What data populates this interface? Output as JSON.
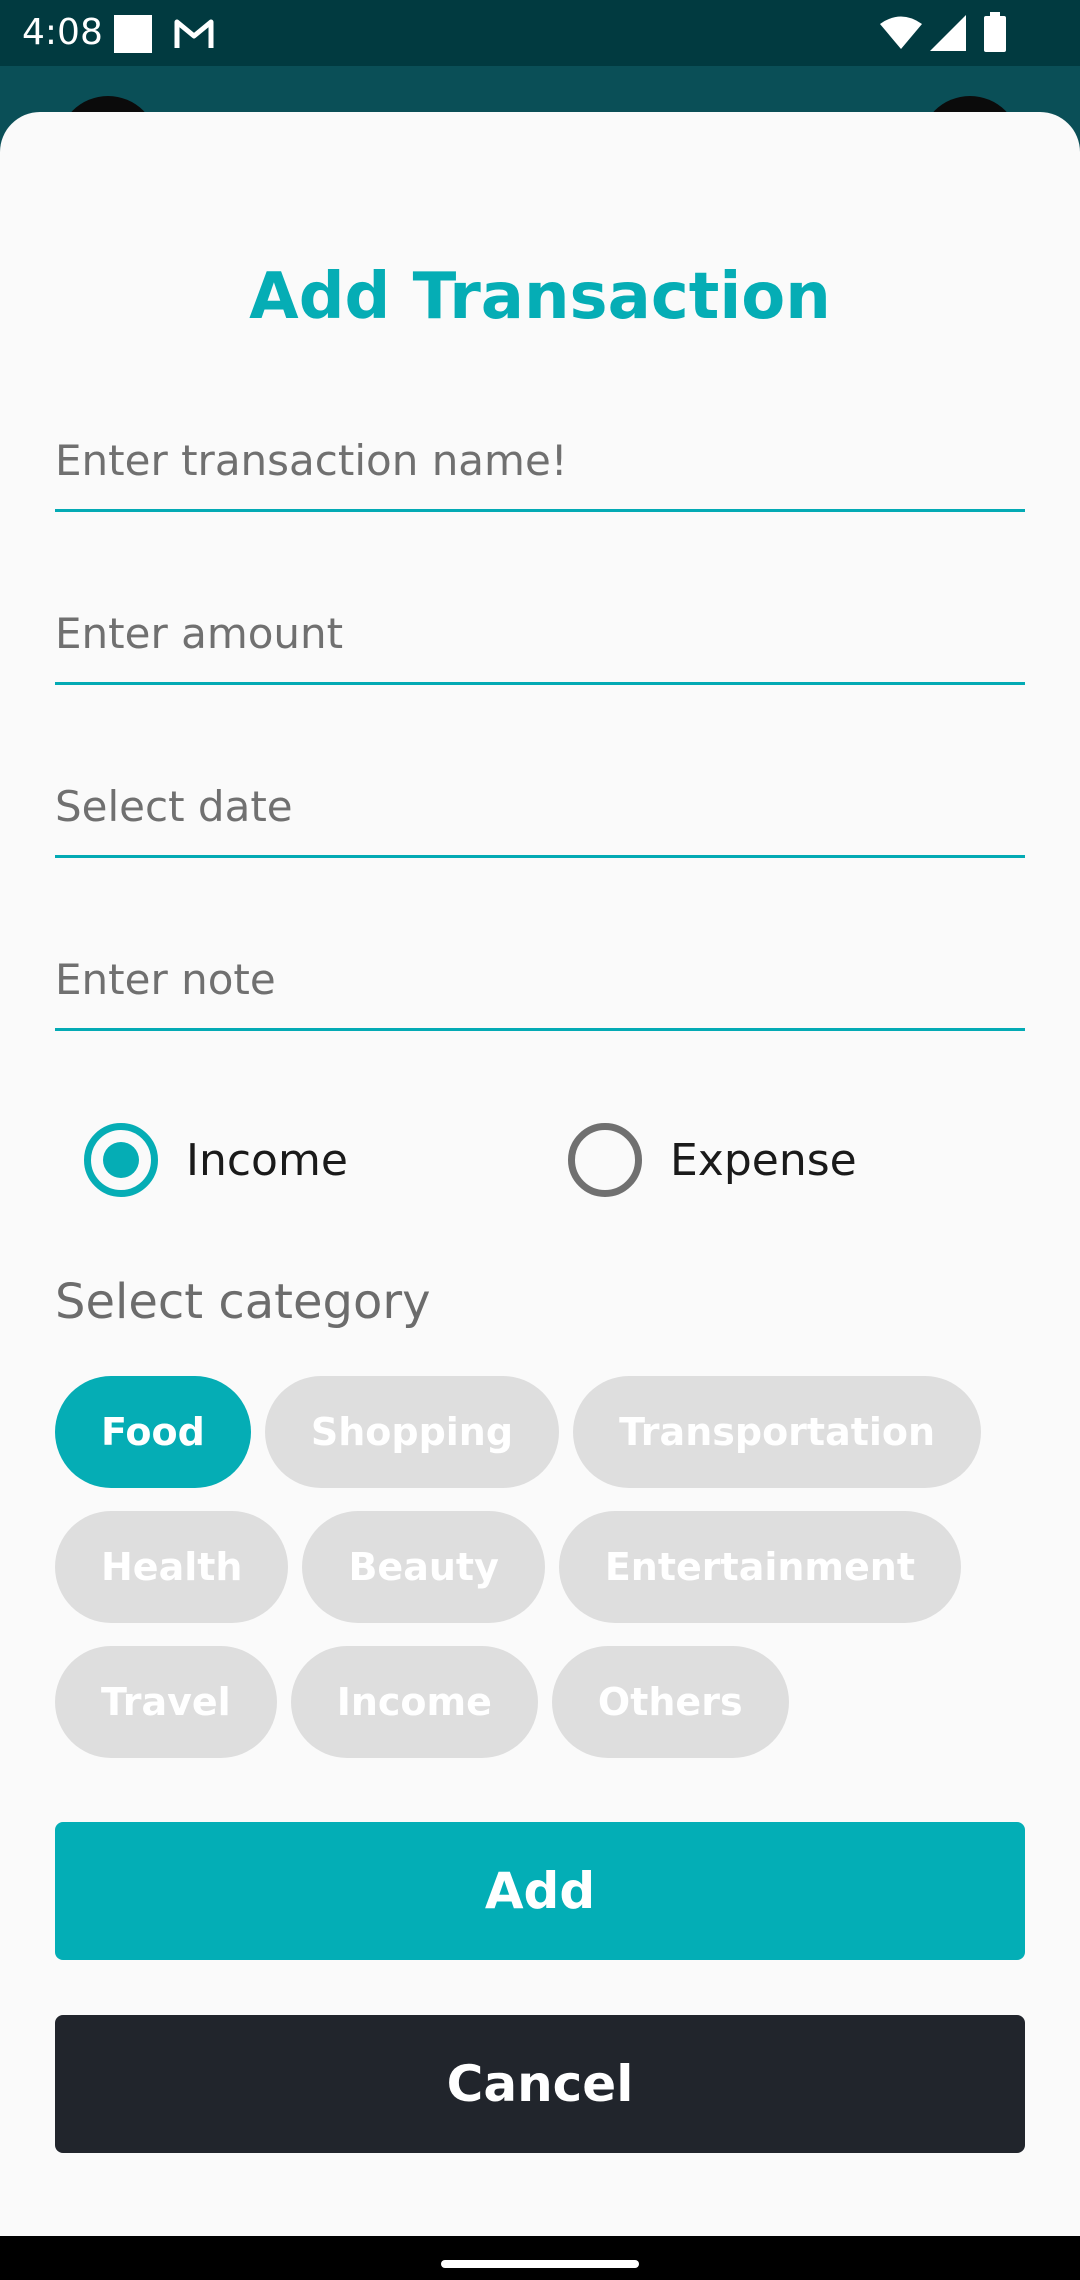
{
  "status_bar": {
    "time": "4:08",
    "icons": [
      "notification-square-icon",
      "gmail-icon",
      "wifi-icon",
      "signal-icon",
      "battery-icon"
    ]
  },
  "dialog": {
    "title": "Add Transaction",
    "fields": {
      "name_placeholder": "Enter transaction name!",
      "amount_placeholder": "Enter amount",
      "date_placeholder": "Select date",
      "note_placeholder": "Enter note"
    },
    "type": {
      "options": [
        "Income",
        "Expense"
      ],
      "selected": "Income"
    },
    "category_label": "Select category",
    "categories": [
      "Food",
      "Shopping",
      "Transportation",
      "Health",
      "Beauty",
      "Entertainment",
      "Travel",
      "Income",
      "Others"
    ],
    "selected_category": "Food",
    "add_label": "Add",
    "cancel_label": "Cancel"
  },
  "colors": {
    "accent": "#05adb5",
    "dark_button": "#21252c",
    "chip_unselected": "#dedede",
    "status_bar": "#013a40"
  }
}
